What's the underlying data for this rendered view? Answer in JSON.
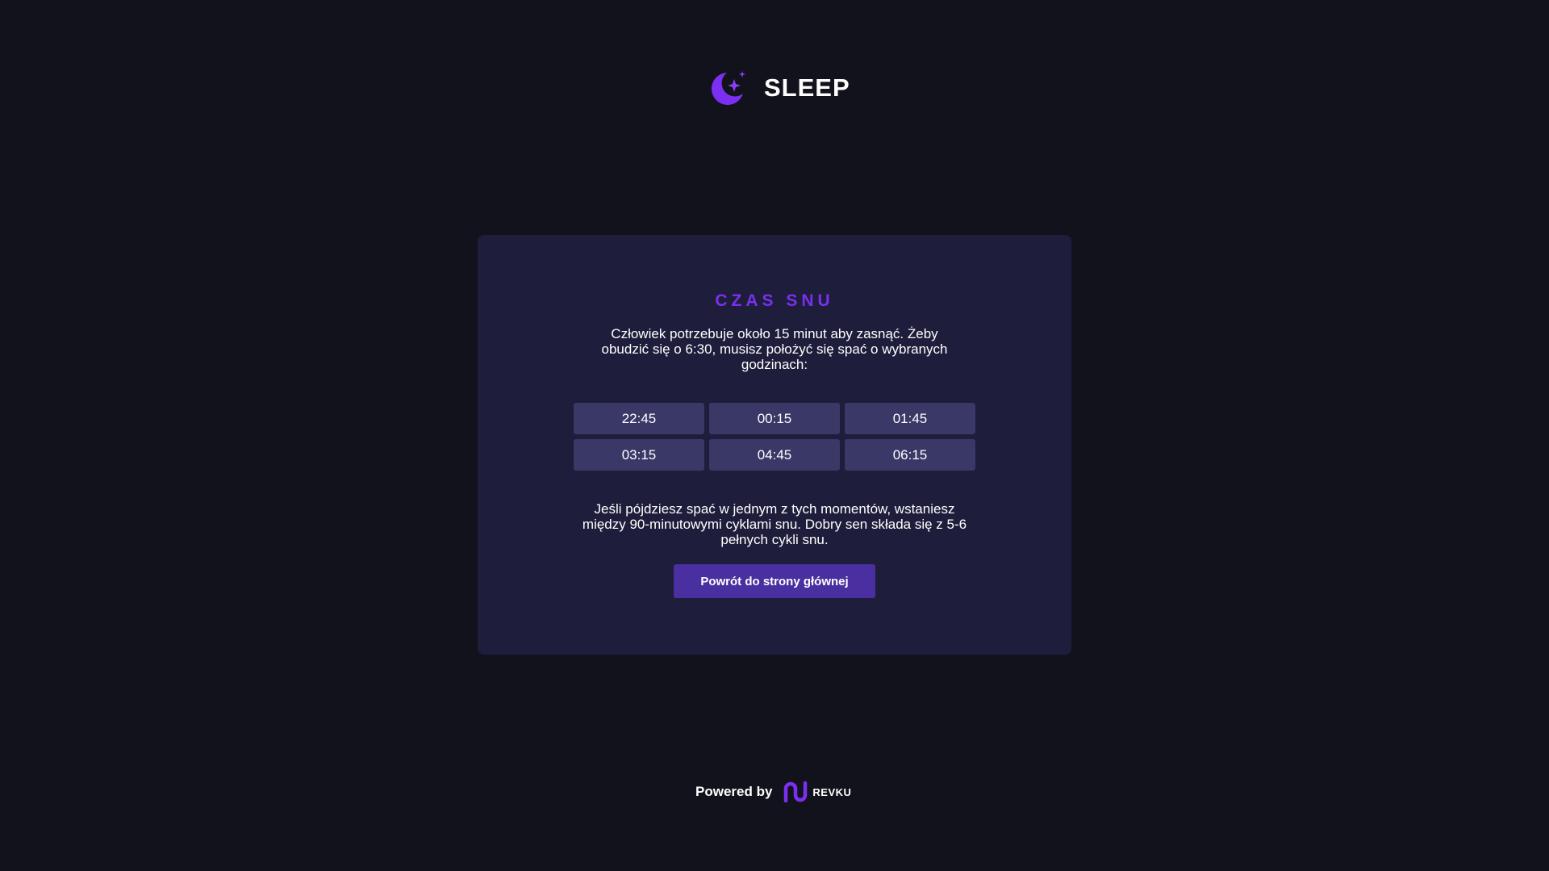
{
  "header": {
    "logo_icon": "moon-stars-icon",
    "logo_text": "SLEEP"
  },
  "card": {
    "title": "CZAS SNU",
    "intro": "Człowiek potrzebuje około 15 minut aby zasnąć. Żeby obudzić się o 6:30, musisz położyć się spać o wybranych godzinach:",
    "times": [
      "22:45",
      "00:15",
      "01:45",
      "03:15",
      "04:45",
      "06:15"
    ],
    "note": "Jeśli pójdziesz spać w jednym z tych momentów, wstaniesz między 90-minutowymi cyklami snu. Dobry sen składa się z 5-6 pełnych cykli snu.",
    "back_button_label": "Powrót do strony głównej"
  },
  "footer": {
    "powered_label": "Powered by",
    "brand_icon": "revku-logo-icon",
    "brand_name": "REVKU"
  },
  "colors": {
    "background": "#12121c",
    "card": "#1e1d3b",
    "accent": "#7b2ff0",
    "chip": "#3a3867",
    "button": "#4a2fa0"
  }
}
